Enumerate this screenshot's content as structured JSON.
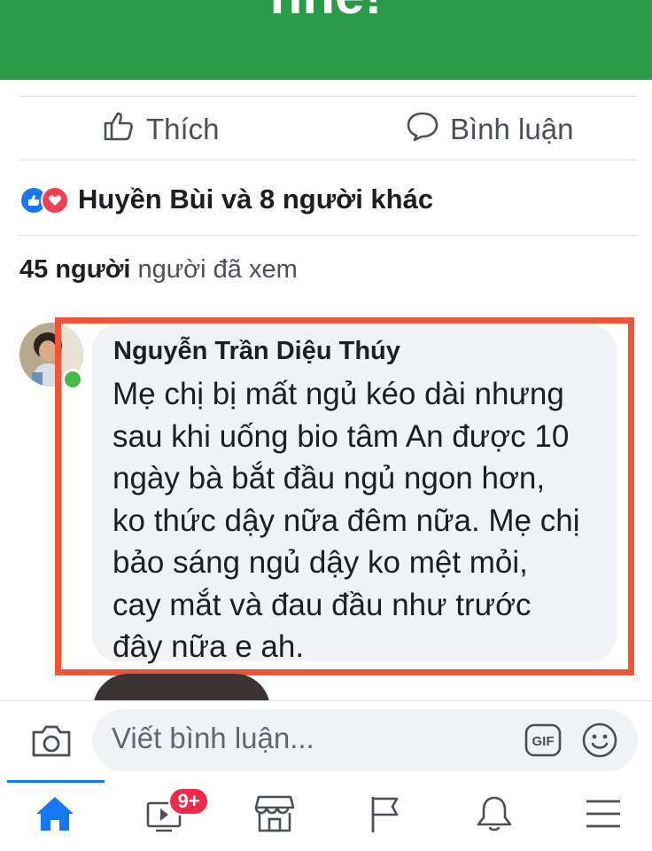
{
  "banner": {
    "partial_text": "nhé!"
  },
  "actions": {
    "like_label": "Thích",
    "comment_label": "Bình luận"
  },
  "reactions": {
    "summary": "Huyền Bùi và 8 người khác"
  },
  "views": {
    "count": "45 người",
    "rest": "người đã xem"
  },
  "comment": {
    "author": "Nguyễn Trần Diệu Thúy",
    "lines": [
      "Mẹ chị bị mất ngủ kéo dài nhưng",
      "sau khi uống bio tâm An được 10",
      "ngày bà bắt đầu ngủ ngon hơn,",
      "ko thức dậy nữa đêm nữa. Mẹ chị",
      "bảo sáng ngủ dậy ko mệt mỏi,",
      "cay mắt và đau đầu như trước",
      "đây nữa e ah."
    ]
  },
  "composer": {
    "placeholder": "Viết bình luận...",
    "gif_label": "GIF"
  },
  "tabbar": {
    "watch_badge": "9+"
  },
  "colors": {
    "accent": "#1877f2",
    "highlight": "#f0553a",
    "banner": "#2b9a48",
    "badge": "#f02849"
  }
}
